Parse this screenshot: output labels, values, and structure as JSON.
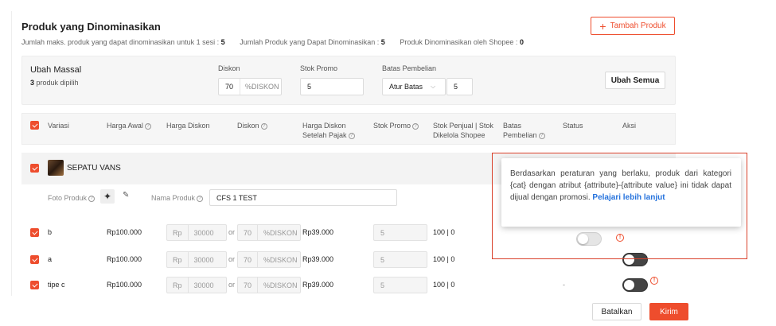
{
  "section": {
    "title": "Produk yang Dinominasikan",
    "summary": [
      {
        "label": "Jumlah maks. produk yang dapat dinominasikan untuk 1 sesi :",
        "value": "5"
      },
      {
        "label": "Jumlah Produk yang Dapat Dinominasikan :",
        "value": "5"
      },
      {
        "label": "Produk Dinominasikan oleh Shopee :",
        "value": "0"
      }
    ],
    "add_button": "Tambah Produk"
  },
  "mass_edit": {
    "title": "Ubah Massal",
    "selected_count": "3",
    "selected_suffix": "produk dipilih",
    "discount_label": "Diskon",
    "discount_value": "70",
    "discount_unit": "%DISKON",
    "stock_label": "Stok Promo",
    "stock_value": "5",
    "limit_label": "Batas Pembelian",
    "limit_option": "Atur Batas",
    "limit_value": "5",
    "apply_button": "Ubah Semua"
  },
  "table": {
    "headers": {
      "variant": "Variasi",
      "original_price": "Harga Awal",
      "discount_price": "Harga Diskon",
      "discount": "Diskon",
      "after_tax_line1": "Harga Diskon",
      "after_tax_line2": "Setelah Pajak",
      "promo_stock": "Stok Promo",
      "seller_stock_line1": "Stok Penjual | Stok",
      "seller_stock_line2": "Dikelola Shopee",
      "limit_line1": "Batas",
      "limit_line2": "Pembelian",
      "status": "Status",
      "action": "Aksi"
    },
    "product": {
      "name": "SEPATU VANS",
      "photo_label": "Foto Produk",
      "name_label": "Nama Produk",
      "name_value": "CFS 1 TEST"
    },
    "rows": [
      {
        "variant": "b",
        "original_price": "Rp100.000",
        "currency": "Rp",
        "price": "30000",
        "or": "or",
        "discount": "70",
        "discount_unit": "%DISKON",
        "after_tax": "Rp39.000",
        "promo_stock": "5",
        "stock": "100 | 0",
        "status": ""
      },
      {
        "variant": "a",
        "original_price": "Rp100.000",
        "currency": "Rp",
        "price": "30000",
        "or": "or",
        "discount": "70",
        "discount_unit": "%DISKON",
        "after_tax": "Rp39.000",
        "promo_stock": "5",
        "stock": "100 | 0",
        "status": ""
      },
      {
        "variant": "tipe c",
        "original_price": "Rp100.000",
        "currency": "Rp",
        "price": "30000",
        "or": "or",
        "discount": "70",
        "discount_unit": "%DISKON",
        "after_tax": "Rp39.000",
        "promo_stock": "5",
        "stock": "100 | 0",
        "status": "-"
      }
    ]
  },
  "tooltip": {
    "text": "Berdasarkan peraturan yang berlaku, produk dari kategori {cat} dengan atribut {attribute}-{attribute value} ini tidak dapat dijual dengan promosi.",
    "link": "Pelajari lebih lanjut"
  },
  "footer": {
    "cancel": "Batalkan",
    "submit": "Kirim"
  },
  "colors": {
    "brand": "#ee4d2d",
    "link": "#2673dd"
  }
}
